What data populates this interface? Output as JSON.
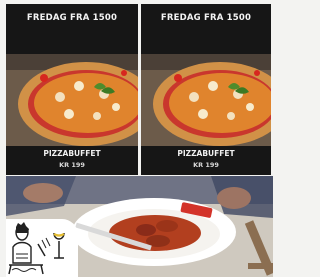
{
  "promos": [
    {
      "title": "FREDAG FRA 1500",
      "label": "PIZZABUFFET",
      "price": "KR 199"
    },
    {
      "title": "FREDAG FRA 1500",
      "label": "PIZZABUFFET",
      "price": "KR 199"
    }
  ],
  "icons": {
    "restaurant": "restaurant-icon"
  }
}
